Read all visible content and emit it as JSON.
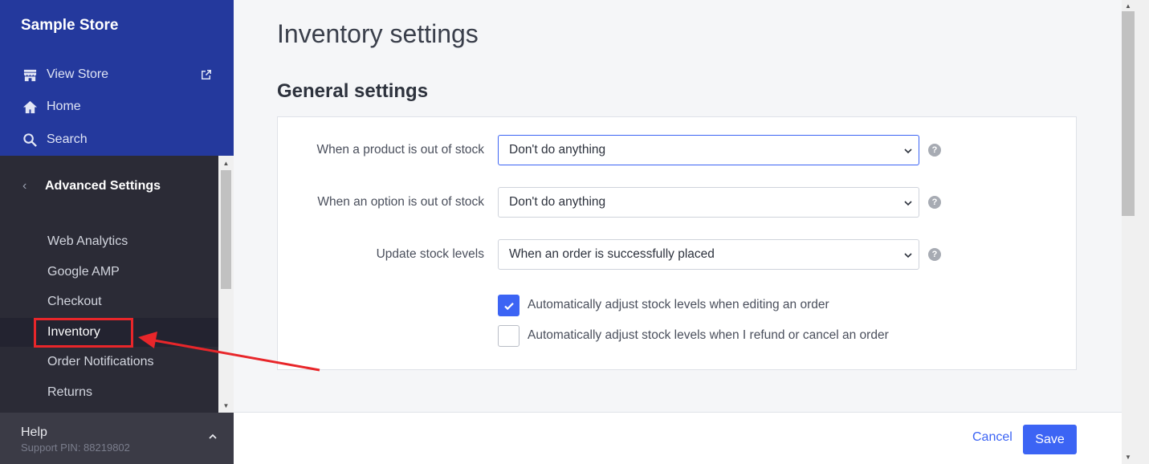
{
  "sidebar": {
    "store_name": "Sample Store",
    "top_links": [
      {
        "label": "View Store",
        "icon": "store-icon"
      },
      {
        "label": "Home",
        "icon": "home-icon"
      },
      {
        "label": "Search",
        "icon": "search-icon"
      }
    ],
    "section_title": "Advanced Settings",
    "items": [
      {
        "label": "Web Analytics"
      },
      {
        "label": "Google AMP"
      },
      {
        "label": "Checkout"
      },
      {
        "label": "Inventory",
        "active": true
      },
      {
        "label": "Order Notifications"
      },
      {
        "label": "Returns"
      }
    ],
    "help_label": "Help",
    "support_pin": "Support PIN: 88219802"
  },
  "main": {
    "page_title": "Inventory settings",
    "section_title": "General settings",
    "fields": [
      {
        "label": "When a product is out of stock",
        "value": "Don't do anything"
      },
      {
        "label": "When an option is out of stock",
        "value": "Don't do anything"
      },
      {
        "label": "Update stock levels",
        "value": "When an order is successfully placed"
      }
    ],
    "checkboxes": [
      {
        "label": "Automatically adjust stock levels when editing an order",
        "checked": true
      },
      {
        "label": "Automatically adjust stock levels when I refund or cancel an order",
        "checked": false
      }
    ],
    "help_glyph": "?"
  },
  "footer": {
    "cancel_label": "Cancel",
    "save_label": "Save"
  },
  "colors": {
    "sidebar_top": "#24399d",
    "sidebar": "#2b2b36",
    "accent": "#3c64f4",
    "annotation": "#e8262a"
  }
}
